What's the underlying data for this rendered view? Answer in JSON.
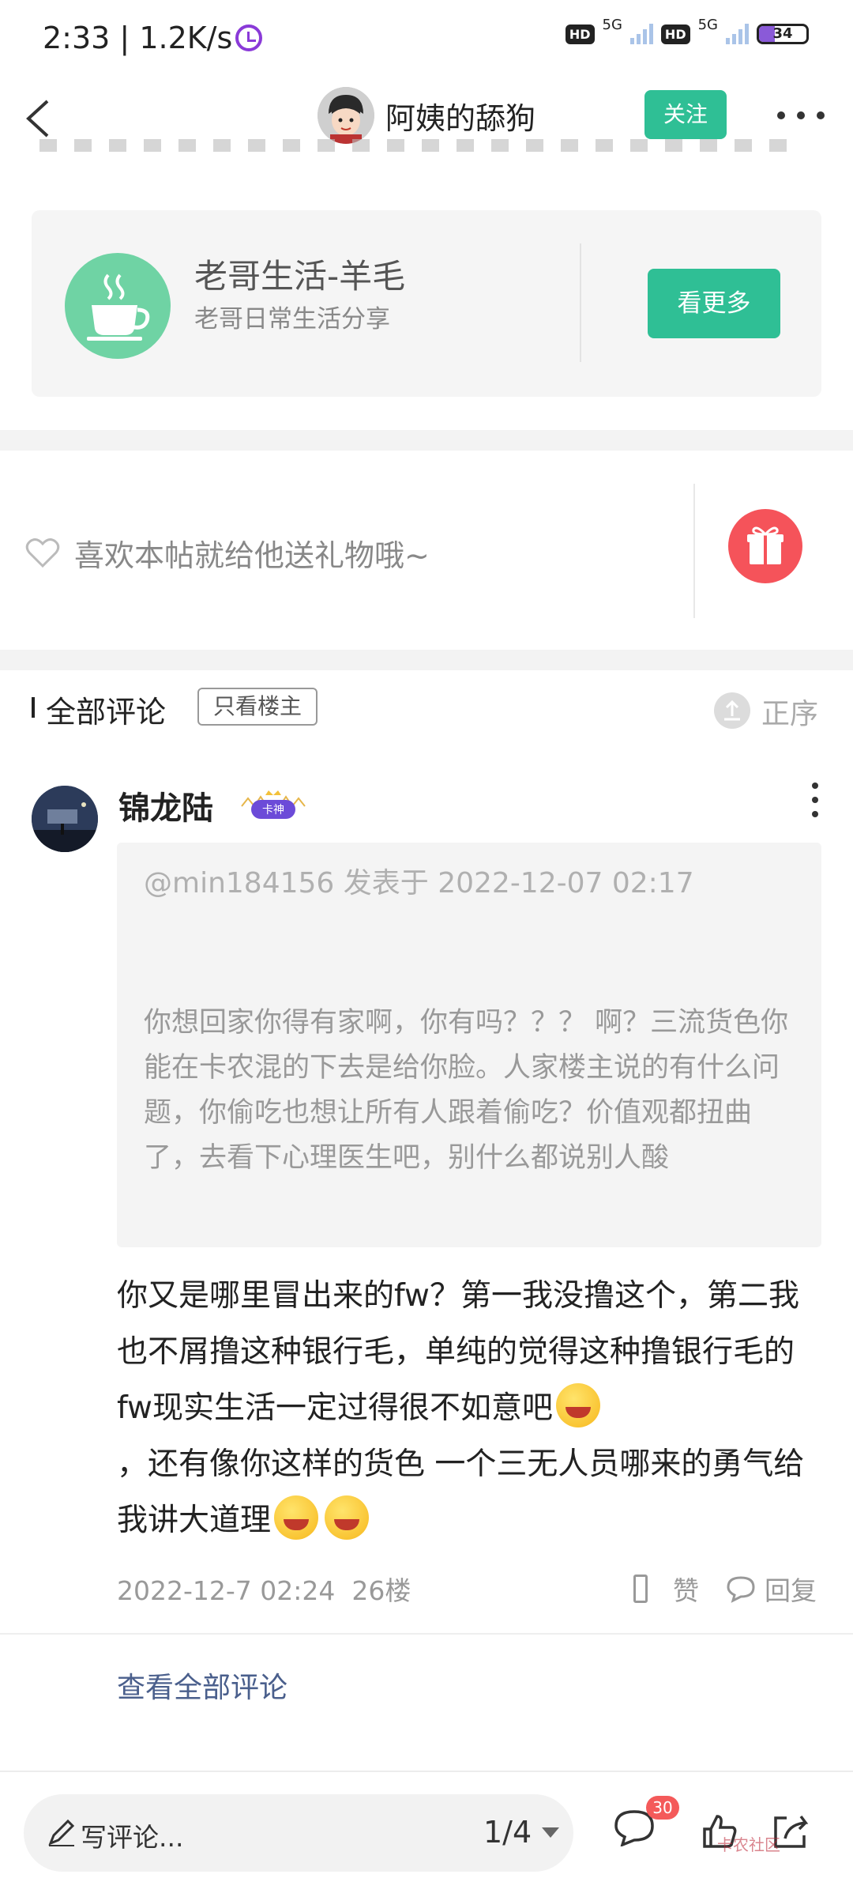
{
  "status_bar": {
    "time": "2:33",
    "speed": "1.2K/s",
    "net1": "5G",
    "net2": "5G",
    "hd": "HD",
    "battery": "34"
  },
  "header": {
    "author_name": "阿姨的舔狗",
    "follow_label": "关注"
  },
  "circle_card": {
    "title": "老哥生活-羊毛",
    "subtitle": "老哥日常生活分享",
    "button_label": "看更多"
  },
  "gift": {
    "text": "喜欢本帖就给他送礼物哦~"
  },
  "comments_header": {
    "title": "全部评论",
    "filter_label": "只看楼主",
    "sort_label": "正序"
  },
  "comment": {
    "username": "锦龙陆",
    "badge": "卡神",
    "quote_header": "@min184156 发表于 2022-12-07 02:17",
    "quote_text": "你想回家你得有家啊，你有吗？？？ 啊？三流货色你能在卡农混的下去是给你脸。人家楼主说的有什么问题，你偷吃也想让所有人跟着偷吃？价值观都扭曲了，去看下心理医生吧，别什么都说别人酸",
    "body_part1": "你又是哪里冒出来的fw？第一我没撸这个，第二我也不屑撸这种银行毛，单纯的觉得这种撸银行毛的fw现实生活一定过得很不如意吧",
    "body_part2": "，还有像你这样的货色 一个三无人员哪来的勇气给我讲大道理",
    "timestamp": "2022-12-7 02:24",
    "floor": "26楼",
    "like_label": "赞",
    "reply_label": "回复"
  },
  "view_all_label": "查看全部评论",
  "bottom_bar": {
    "write_placeholder": "写评论...",
    "page_indicator": "1/4",
    "comment_count": "30",
    "watermark": "卡农社区"
  },
  "colors": {
    "accent": "#2fbf95",
    "gift_red": "#f5535a",
    "link": "#4a5f8c",
    "badge_red": "#f45a5a"
  }
}
